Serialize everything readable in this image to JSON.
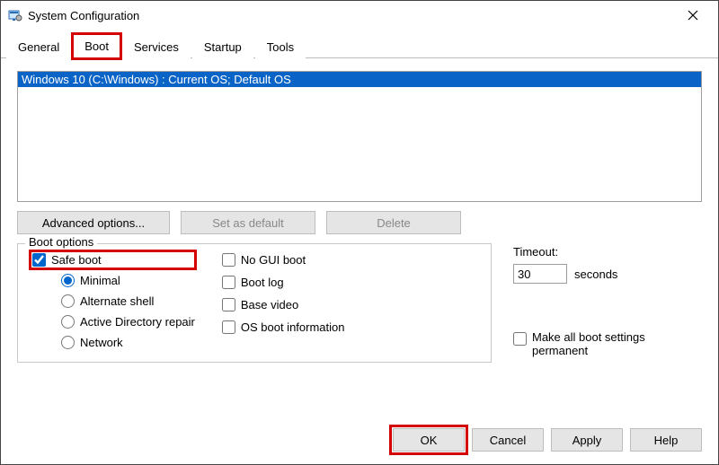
{
  "window": {
    "title": "System Configuration"
  },
  "tabs": {
    "general": "General",
    "boot": "Boot",
    "services": "Services",
    "startup": "Startup",
    "tools": "Tools",
    "active": "boot"
  },
  "boot_list": {
    "entry": "Windows 10 (C:\\Windows) : Current OS; Default OS"
  },
  "buttons": {
    "advanced": "Advanced options...",
    "set_default": "Set as default",
    "delete": "Delete",
    "ok": "OK",
    "cancel": "Cancel",
    "apply": "Apply",
    "help": "Help"
  },
  "boot_options": {
    "legend": "Boot options",
    "safe_boot": {
      "label": "Safe boot",
      "checked": true
    },
    "radios": {
      "minimal": "Minimal",
      "alt_shell": "Alternate shell",
      "ad_repair": "Active Directory repair",
      "network": "Network",
      "selected": "minimal"
    },
    "checks": {
      "no_gui": {
        "label": "No GUI boot",
        "checked": false
      },
      "boot_log": {
        "label": "Boot log",
        "checked": false
      },
      "base_video": {
        "label": "Base video",
        "checked": false
      },
      "os_info": {
        "label": "OS boot information",
        "checked": false
      }
    }
  },
  "timeout": {
    "label": "Timeout:",
    "value": "30",
    "unit": "seconds"
  },
  "permanent": {
    "label": "Make all boot settings permanent",
    "checked": false
  }
}
